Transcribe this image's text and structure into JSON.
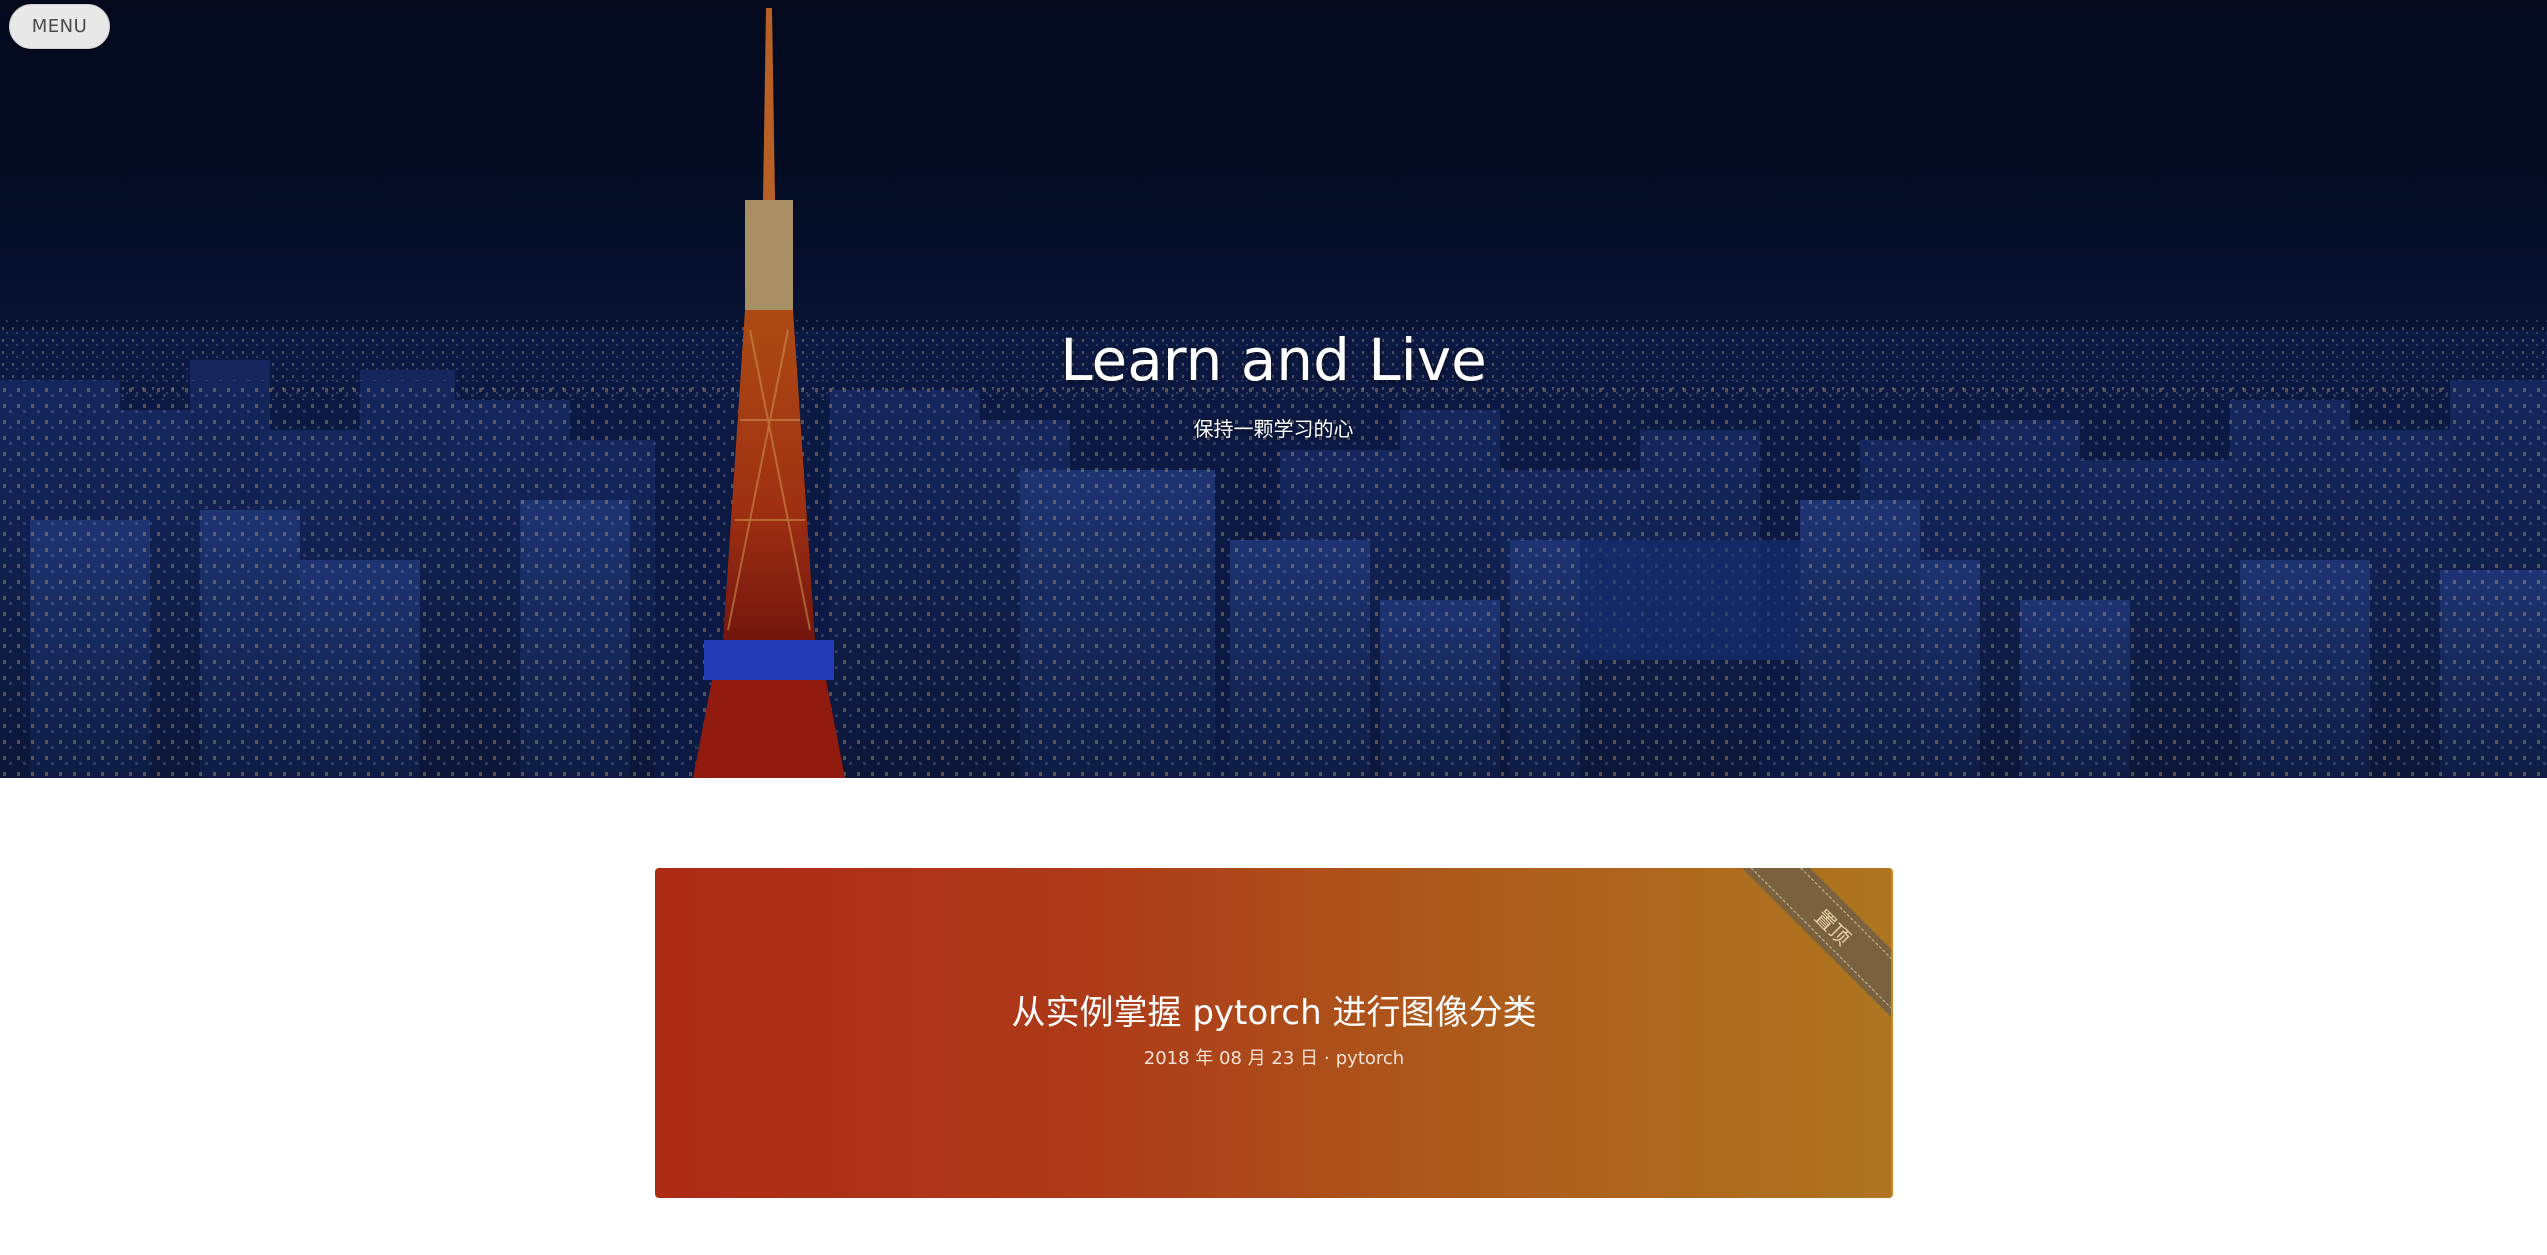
{
  "header": {
    "menu_label": "MENU"
  },
  "hero": {
    "title": "Learn and Live",
    "subtitle": "保持一颗学习的心"
  },
  "posts": [
    {
      "title": "从实例掌握 pytorch 进行图像分类",
      "date": "2018 年 08 月 23 日",
      "separator": "·",
      "tag": "pytorch",
      "badge": "置顶",
      "colors": {
        "gradient_start": "#ad2a14",
        "gradient_end": "#ae7520",
        "ribbon": "#7a6240"
      }
    }
  ]
}
